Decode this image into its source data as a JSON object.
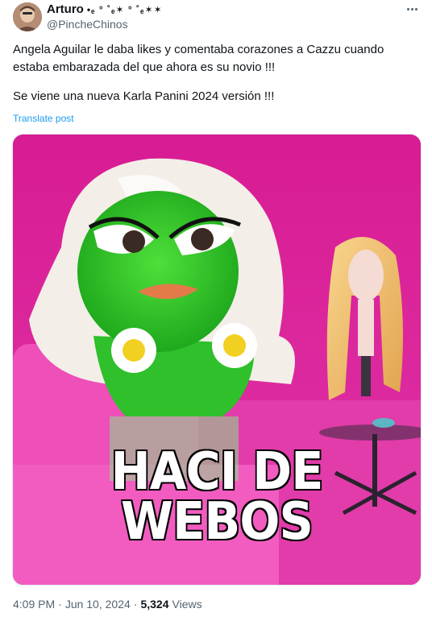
{
  "author": {
    "display_name": "Arturo",
    "name_decoration": "•ₑ ° ˚ₑ✶ ° ˚ₑ✶✶",
    "handle": "@PincheChinos"
  },
  "menu": {
    "more_icon": "more-horizontal-icon"
  },
  "tweet": {
    "paragraph_1": "Angela Aguilar le daba likes y comentaba corazones a Cazzu cuando estaba embarazada del que ahora es su novio !!!",
    "paragraph_2": "Se viene una nueva Karla Panini 2024 versión !!!",
    "translate_label": "Translate post"
  },
  "media": {
    "caption_line_1": "HACI DE",
    "caption_line_2": "WEBOS"
  },
  "meta": {
    "time": "4:09 PM",
    "separator_1": "·",
    "date": "Jun 10, 2024",
    "separator_2": "·",
    "views_count": "5,324",
    "views_label": "Views"
  },
  "colors": {
    "link": "#1d9bf0",
    "secondary_text": "#536471",
    "primary_text": "#0f1419",
    "media_background": "#d61f96"
  }
}
